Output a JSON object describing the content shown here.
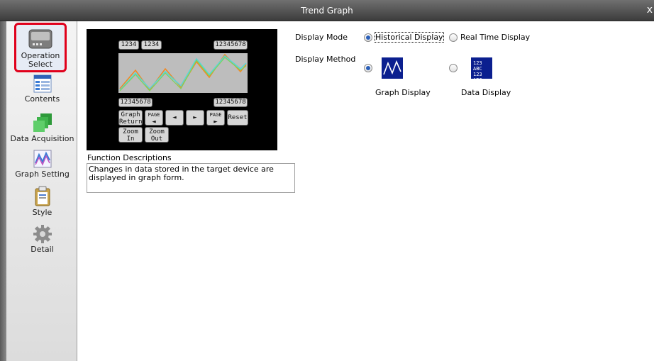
{
  "window": {
    "title": "Trend Graph",
    "close": "x"
  },
  "sidebar": {
    "items": [
      {
        "label": "Operation\nSelect",
        "icon": "operation-select-icon"
      },
      {
        "label": "Contents",
        "icon": "contents-icon"
      },
      {
        "label": "Data Acquisition",
        "icon": "data-acquisition-icon"
      },
      {
        "label": "Graph Setting",
        "icon": "graph-setting-icon"
      },
      {
        "label": "Style",
        "icon": "style-icon"
      },
      {
        "label": "Detail",
        "icon": "detail-icon"
      }
    ]
  },
  "preview": {
    "top_labels": [
      "1234",
      "1234",
      "12345678"
    ],
    "bottom_labels": [
      "12345678",
      "12345678"
    ],
    "buttons": {
      "graph_return": "Graph\nReturn",
      "page_prev": "PAGE",
      "prev": "◄",
      "next": "►",
      "page_next": "PAGE",
      "reset": "Reset",
      "zoom_in": "Zoom\nIn",
      "zoom_out": "Zoom\nOut"
    }
  },
  "function_descriptions": {
    "label": "Function Descriptions",
    "text": "Changes in data stored in the target device are displayed in graph form."
  },
  "display_mode": {
    "label": "Display Mode",
    "options": [
      "Historical Display",
      "Real Time Display"
    ],
    "selected": "Historical Display"
  },
  "display_method": {
    "label": "Display Method",
    "options": [
      "Graph Display",
      "Data Display"
    ],
    "selected": "Graph Display",
    "data_thumb_text": [
      "123 ABC",
      "123 ABC"
    ]
  },
  "colors": {
    "selection_border": "#e0001b",
    "radio_dot": "#2a5fb8",
    "thumb_bg": "#0b1f8f"
  }
}
